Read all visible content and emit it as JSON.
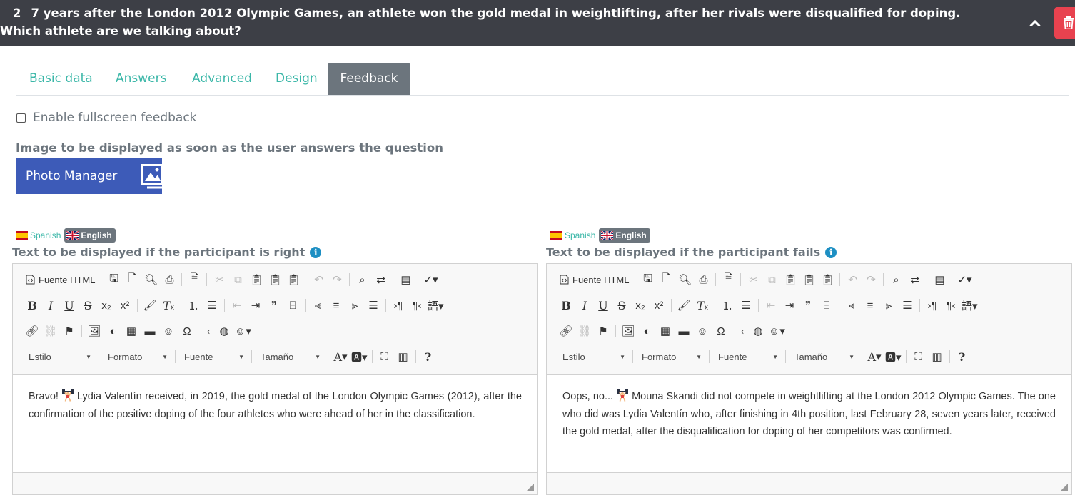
{
  "question": {
    "number": "2",
    "text": "7 years after the London 2012 Olympic Games, an athlete won the gold medal in weightlifting, after her rivals were disqualified for doping. Which athlete are we talking about?"
  },
  "tabs": [
    {
      "label": "Basic data",
      "active": false
    },
    {
      "label": "Answers",
      "active": false
    },
    {
      "label": "Advanced",
      "active": false
    },
    {
      "label": "Design",
      "active": false
    },
    {
      "label": "Feedback",
      "active": true
    }
  ],
  "fullscreen_label": "Enable fullscreen feedback",
  "image_label": "Image to be displayed as soon as the user answers the question",
  "photo_manager_label": "Photo Manager",
  "languages": {
    "spanish": "Spanish",
    "english": "English"
  },
  "toolbar": {
    "source": "Fuente HTML",
    "estilo": "Estilo",
    "formato": "Formato",
    "fuente": "Fuente",
    "tamano": "Tamaño",
    "help": "?"
  },
  "editors": {
    "right": {
      "label": "Text to be displayed if the participant is right",
      "lead": "Bravo!",
      "body": "Lydia Valentín received, in 2019, the gold medal of the London Olympic Games (2012), after the confirmation of the positive doping of the four athletes who were ahead of her in the classification."
    },
    "wrong": {
      "label": "Text to be displayed if the participant fails",
      "lead": "Oops, no...",
      "body": "Mouna Skandi did not compete in weightlifting at the London 2012 Olympic Games. The one who did was Lydia Valentín who, after finishing in 4th position, last February 28, seven years later, received the gold medal, after the disqualification for doping of her competitors was confirmed."
    }
  },
  "colors": {
    "topbar": "#3d3f46",
    "accent": "#3bb7a8",
    "active_tab": "#6c757d",
    "photo_button": "#3d5bb8",
    "delete": "#e8424f",
    "info": "#1d8fc3"
  }
}
